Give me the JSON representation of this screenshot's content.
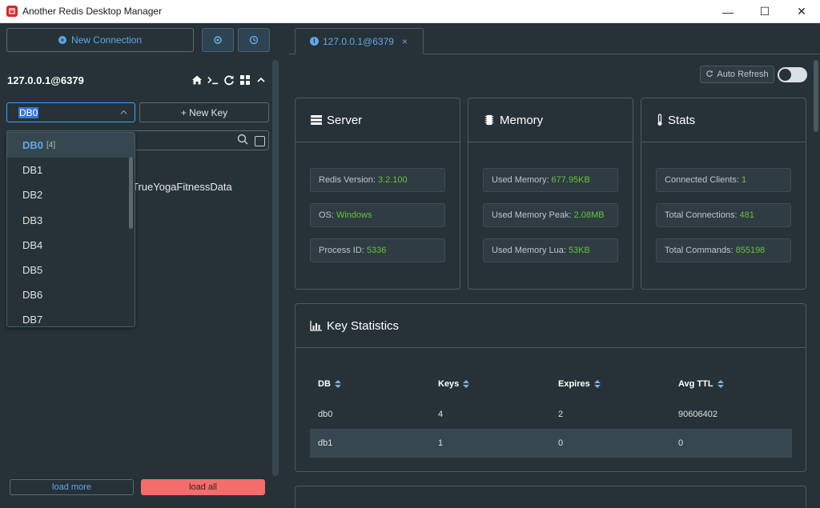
{
  "window": {
    "title": "Another Redis Desktop Manager",
    "minimize": "—",
    "maximize": "☐",
    "close": "✕"
  },
  "sidebar": {
    "new_connection_label": "New Connection",
    "connection_name": "127.0.0.1@6379",
    "db_select": {
      "value": "DB0"
    },
    "new_key_label": "+ New Key",
    "search": {
      "placeholder": ""
    },
    "keys": [
      "TrueYogaFitnessData"
    ],
    "db_options": [
      {
        "label": "DB0",
        "count": "[4]"
      },
      {
        "label": "DB1"
      },
      {
        "label": "DB2"
      },
      {
        "label": "DB3"
      },
      {
        "label": "DB4"
      },
      {
        "label": "DB5"
      },
      {
        "label": "DB6"
      },
      {
        "label": "DB7"
      }
    ],
    "load_more_label": "load more",
    "load_all_label": "load all"
  },
  "tab": {
    "label": "127.0.0.1@6379",
    "close": "×"
  },
  "toolbar": {
    "auto_refresh_label": "Auto Refresh",
    "auto_refresh_on": false
  },
  "cards": {
    "server": {
      "title": "Server",
      "items": [
        {
          "label": "Redis Version:",
          "value": "3.2.100"
        },
        {
          "label": "OS:",
          "value": "Windows"
        },
        {
          "label": "Process ID:",
          "value": "5336"
        }
      ]
    },
    "memory": {
      "title": "Memory",
      "items": [
        {
          "label": "Used Memory:",
          "value": "677.95KB"
        },
        {
          "label": "Used Memory Peak:",
          "value": "2.08MB"
        },
        {
          "label": "Used Memory Lua:",
          "value": "53KB"
        }
      ]
    },
    "stats": {
      "title": "Stats",
      "items": [
        {
          "label": "Connected Clients:",
          "value": "1"
        },
        {
          "label": "Total Connections:",
          "value": "481"
        },
        {
          "label": "Total Commands:",
          "value": "855198"
        }
      ]
    }
  },
  "key_statistics": {
    "title": "Key Statistics",
    "columns": [
      "DB",
      "Keys",
      "Expires",
      "Avg TTL"
    ],
    "rows": [
      [
        "db0",
        "4",
        "2",
        "90606402"
      ],
      [
        "db1",
        "1",
        "0",
        "0"
      ]
    ]
  },
  "colors": {
    "accent": "#409eff",
    "value_green": "#67c23a",
    "danger": "#f56c6c",
    "bg": "#263238"
  }
}
